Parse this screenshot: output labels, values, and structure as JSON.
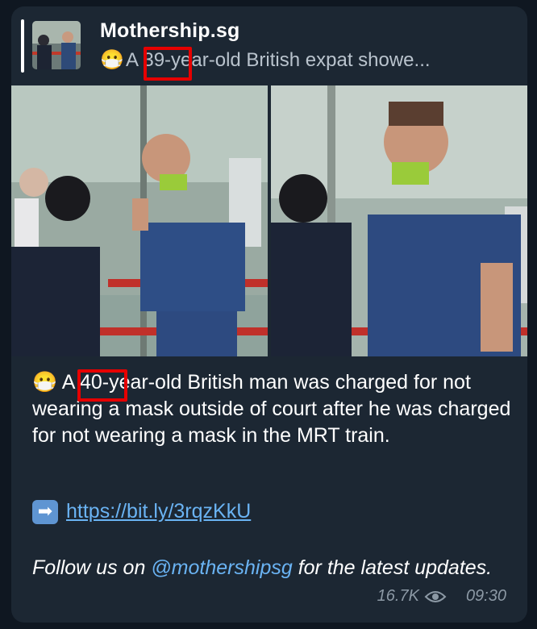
{
  "reply": {
    "title": "Mothership.sg",
    "emoji": "😷",
    "text_prefix": "A ",
    "text_number": "39-",
    "text_suffix": "year-old British expat showe..."
  },
  "caption": {
    "emoji": "😷",
    "prefix": " A ",
    "number": "40-",
    "rest": "year-old British man was charged for not wearing a mask outside of court after he was charged for not wearing a mask in the MRT train."
  },
  "link": {
    "arrow": "➡",
    "url": "https://bit.ly/3rqzKkU"
  },
  "follow": {
    "before": "Follow us on ",
    "mention": "@mothershipsg",
    "after": " for the latest updates."
  },
  "meta": {
    "views": "16.7K",
    "time": "09:30"
  },
  "colors": {
    "bubble": "#1c2733",
    "link": "#6ab3f3",
    "highlight_box": "#e60000"
  }
}
